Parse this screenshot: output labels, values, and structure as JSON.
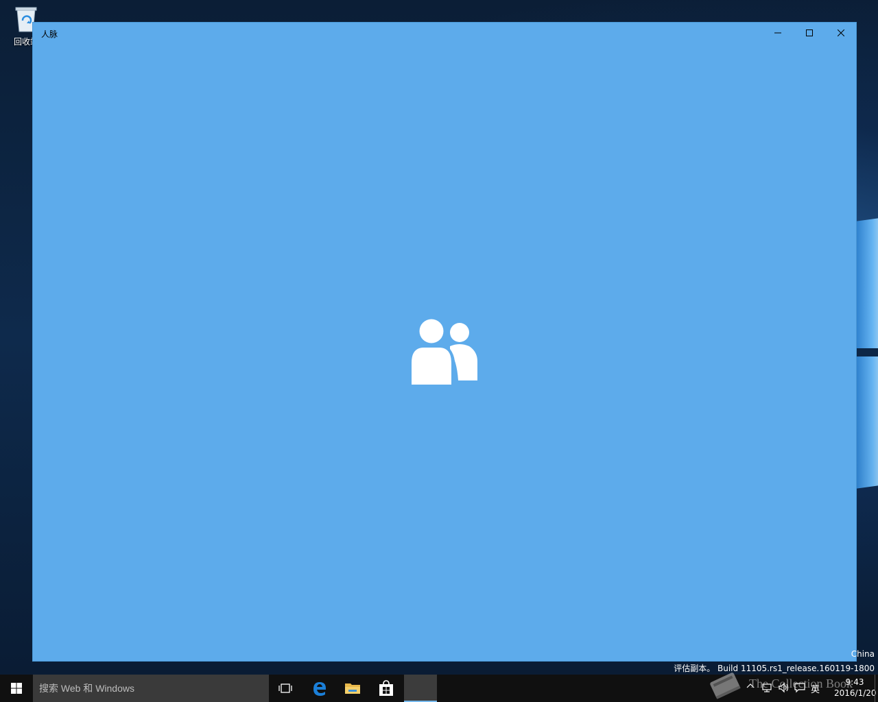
{
  "desktop": {
    "recycle_bin_label": "回收站"
  },
  "window": {
    "title": "人脉",
    "background_color": "#5dabeb",
    "splash_icon": "people-icon",
    "caption_buttons": {
      "minimize": "minimize-icon",
      "maximize": "maximize-icon",
      "close": "close-icon"
    }
  },
  "watermark": {
    "region": "China",
    "build": "评估副本。 Build 11105.rs1_release.160119-1800"
  },
  "taskbar": {
    "search_placeholder": "搜索 Web 和 Windows",
    "pinned": [
      "task-view-icon",
      "edge-icon",
      "file-explorer-icon",
      "store-icon",
      "people-app-icon"
    ],
    "active_app": "people-app-icon",
    "tray": {
      "language": "英",
      "time": "9:43",
      "date": "2016/1/20"
    }
  },
  "overlay_watermark": "The Collection Book"
}
